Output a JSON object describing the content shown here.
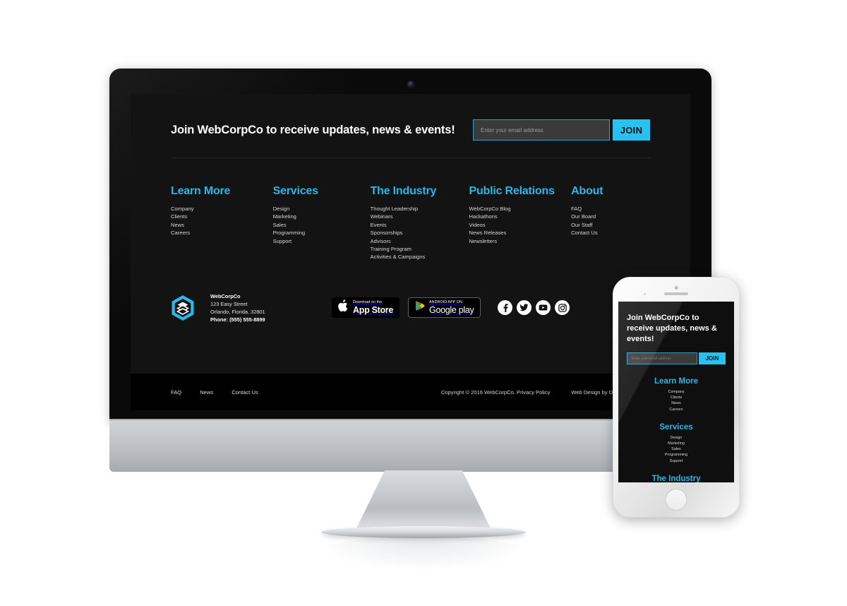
{
  "device": {
    "monitor_name": "desktop-monitor",
    "phone_name": "smartphone"
  },
  "signup": {
    "title": "Join WebCorpCo to receive updates, news & events!",
    "email_placeholder": "Enter your email address",
    "email_value": "",
    "join_label": "JOIN"
  },
  "columns": [
    {
      "heading": "Learn More",
      "links": [
        "Company",
        "Clients",
        "News",
        "Careers"
      ]
    },
    {
      "heading": "Services",
      "links": [
        "Design",
        "Marketing",
        "Sales",
        "Programming",
        "Support"
      ]
    },
    {
      "heading": "The Industry",
      "links": [
        "Thought Leadership",
        "Webinars",
        "Events",
        "Sponsorships",
        "Advisors",
        "Training Program",
        "Activities & Campaigns"
      ]
    },
    {
      "heading": "Public Relations",
      "links": [
        "WebCorpCo Blog",
        "Hackathons",
        "Videos",
        "News Releases",
        "Newsletters"
      ]
    },
    {
      "heading": "About",
      "links": [
        "FAQ",
        "Our Board",
        "Our Staff",
        "Contact Us"
      ]
    }
  ],
  "company": {
    "logo_icon": "hexagon-layers-logo",
    "name": "WebCorpCo",
    "street": "123 Easy Street",
    "city_state_zip": "Orlando, Florida, 32801",
    "phone": "Phone: (555) 555-8899"
  },
  "app_badges": [
    {
      "icon": "apple-icon",
      "small_text": "Download on the",
      "big_text": "App Store"
    },
    {
      "icon": "google-play-icon",
      "small_text": "ANDROID APP ON",
      "big_text": "Google play"
    }
  ],
  "socials": [
    {
      "icon": "facebook-icon",
      "label": "Facebook"
    },
    {
      "icon": "twitter-icon",
      "label": "Twitter"
    },
    {
      "icon": "youtube-icon",
      "label": "YouTube"
    },
    {
      "icon": "instagram-icon",
      "label": "Instagram"
    }
  ],
  "bottom_bar": {
    "links": [
      "FAQ",
      "News",
      "Contact Us"
    ],
    "copyright": "Copyright © 2016 WebCorpCo. Privacy Policy",
    "credit": "Web Design by DigitalUs on Solo"
  },
  "phone_view": {
    "title": "Join WebCorpCo to receive updates, news & events!",
    "email_placeholder": "Enter your email address",
    "join_label": "JOIN",
    "columns": [
      {
        "heading": "Learn More",
        "links": [
          "Company",
          "Clients",
          "News",
          "Careers"
        ]
      },
      {
        "heading": "Services",
        "links": [
          "Design",
          "Marketing",
          "Sales",
          "Programming",
          "Support"
        ]
      },
      {
        "heading": "The Industry",
        "links": []
      }
    ]
  },
  "colors": {
    "accent_cyan": "#29c1f0",
    "heading_cyan": "#29b8ea",
    "footer_bg": "#131313",
    "bottom_bar_bg": "#000000",
    "link_text": "#d6d6d6"
  }
}
